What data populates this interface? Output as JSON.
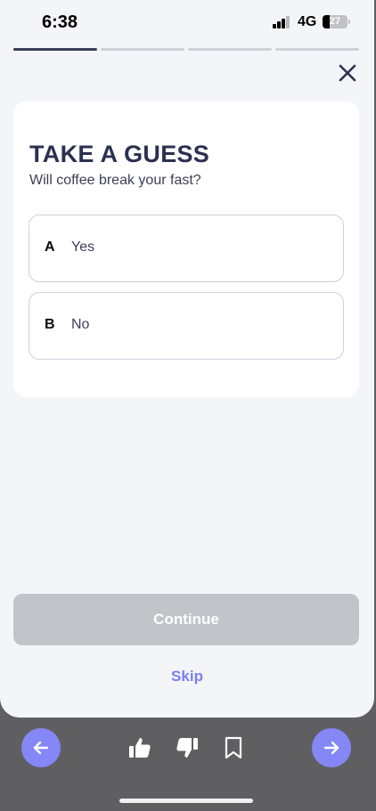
{
  "status_bar": {
    "time": "6:38",
    "network": "4G",
    "battery": "27"
  },
  "progress": {
    "total_steps": 4,
    "current_step": 1
  },
  "card": {
    "title": "TAKE A GUESS",
    "subtitle": "Will coffee break your fast?",
    "options": [
      {
        "letter": "A",
        "label": "Yes"
      },
      {
        "letter": "B",
        "label": "No"
      }
    ]
  },
  "actions": {
    "continue_label": "Continue",
    "skip_label": "Skip"
  },
  "icons": {
    "close": "close-icon",
    "back": "arrow-left-icon",
    "like": "thumbs-up-icon",
    "dislike": "thumbs-down-icon",
    "bookmark": "bookmark-icon",
    "next": "arrow-right-icon"
  },
  "colors": {
    "accent": "#8487f5",
    "title": "#2c3050",
    "continue_disabled": "#c3c4c9",
    "skip": "#7b7ff0",
    "bottom_bar": "#5f5f61"
  }
}
